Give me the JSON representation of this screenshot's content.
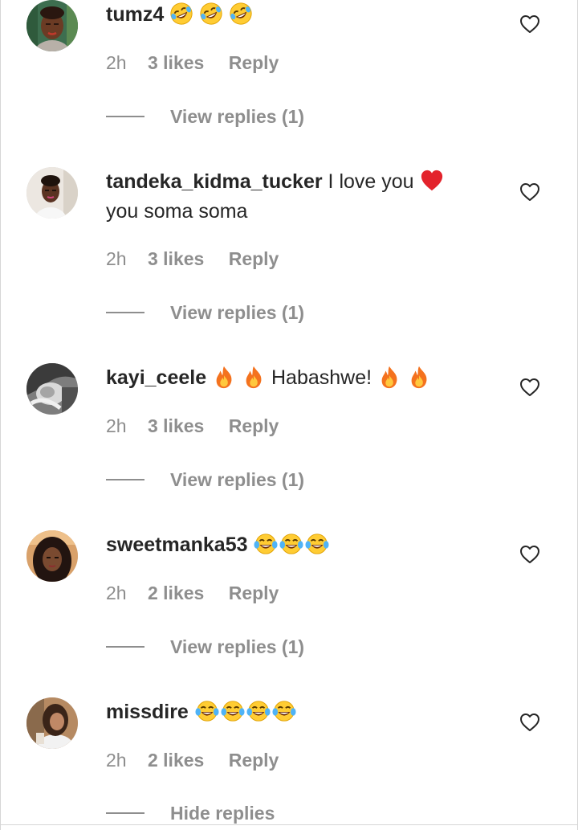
{
  "comments": [
    {
      "username": "tumz4",
      "text": "",
      "text_line2": "",
      "emojis": [
        "rofl-emoji",
        "rofl-emoji",
        "rofl-emoji"
      ],
      "time": "2h",
      "likes": "3 likes",
      "reply": "Reply",
      "thread_label": "View replies (1)"
    },
    {
      "username": "tandeka_kidma_tucker",
      "text": "I love you",
      "text_line2": "you soma soma",
      "emojis": [
        "red-heart-emoji"
      ],
      "time": "2h",
      "likes": "3 likes",
      "reply": "Reply",
      "thread_label": "View replies (1)"
    },
    {
      "username": "kayi_ceele",
      "text": "Habashwe!",
      "text_line2": "",
      "emojis": [
        "fire-emoji",
        "fire-emoji",
        "fire-emoji",
        "fire-emoji"
      ],
      "time": "2h",
      "likes": "3 likes",
      "reply": "Reply",
      "thread_label": "View replies (1)"
    },
    {
      "username": "sweetmanka53",
      "text": "",
      "text_line2": "",
      "emojis": [
        "tears-of-joy-emoji",
        "tears-of-joy-emoji",
        "tears-of-joy-emoji"
      ],
      "time": "2h",
      "likes": "2 likes",
      "reply": "Reply",
      "thread_label": "View replies (1)"
    },
    {
      "username": "missdire",
      "text": "",
      "text_line2": "",
      "emojis": [
        "tears-of-joy-emoji",
        "tears-of-joy-emoji",
        "tears-of-joy-emoji",
        "tears-of-joy-emoji"
      ],
      "time": "2h",
      "likes": "2 likes",
      "reply": "Reply",
      "thread_label": "Hide replies"
    }
  ],
  "icons": {
    "like": "heart-outline-icon"
  },
  "colors": {
    "text": "#262626",
    "secondary": "#8e8e8e",
    "background": "#ffffff"
  }
}
